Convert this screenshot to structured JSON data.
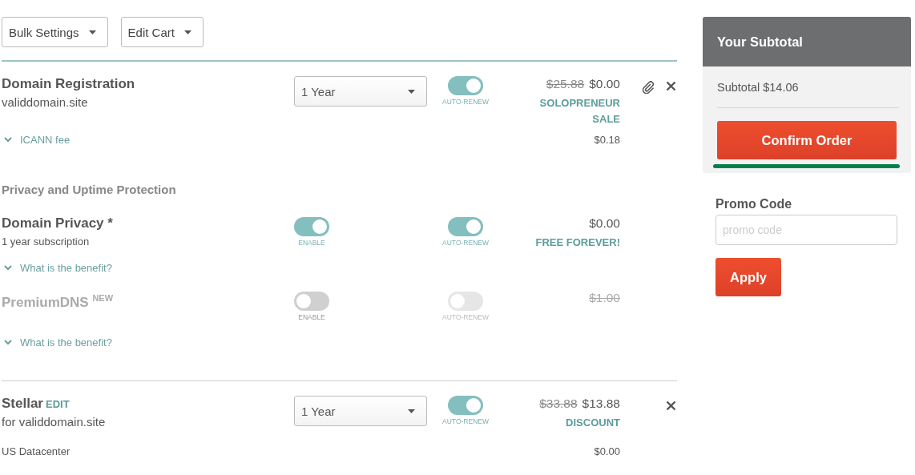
{
  "toolbar": [
    {
      "label": "Bulk Settings"
    },
    {
      "label": "Edit Cart"
    }
  ],
  "cart": {
    "items": [
      {
        "kind": "product",
        "title": "Domain Registration",
        "subtitle": "validdomain.site",
        "term": "1 Year",
        "auto_renew": {
          "label": "AUTO-RENEW",
          "on": true,
          "disabled": false
        },
        "old_price": "$25.88",
        "price": "$0.00",
        "promo": "SOLOPRENEUR SALE",
        "attachable": true,
        "removable": true,
        "detail": {
          "label": "ICANN fee",
          "expandable": true,
          "price": "$0.18"
        }
      },
      {
        "kind": "heading",
        "title": "Privacy and Uptime Protection"
      },
      {
        "kind": "addon",
        "title": "Domain Privacy *",
        "subtitle": "1 year subscription",
        "disabled": false,
        "enable": {
          "label": "ENABLE",
          "on": true
        },
        "auto_renew": {
          "label": "AUTO-RENEW",
          "on": true,
          "disabled": false
        },
        "price": "$0.00",
        "price_struck": false,
        "promo": "FREE FOREVER!",
        "detail": {
          "label": "What is the benefit?",
          "expandable": true
        }
      },
      {
        "kind": "addon",
        "title": "PremiumDNS $^{NEW}$",
        "disabled": true,
        "enable": {
          "label": "ENABLE",
          "on": false
        },
        "auto_renew": {
          "label": "AUTO-RENEW",
          "on": false,
          "disabled": true
        },
        "price": "$1.00",
        "price_struck": true,
        "detail": {
          "label": "What is the benefit?",
          "expandable": true
        }
      },
      {
        "kind": "divider"
      },
      {
        "kind": "product",
        "title": "Stellar",
        "title_link": "EDIT",
        "subtitle": "for validdomain.site",
        "term": "1 Year",
        "auto_renew": {
          "label": "AUTO-RENEW",
          "on": true,
          "disabled": false
        },
        "old_price": "$33.88",
        "price": "$13.88",
        "promo": "DISCOUNT",
        "attachable": false,
        "removable": true,
        "detail": {
          "label": "US Datacenter",
          "expandable": false,
          "price": "$0.00"
        }
      }
    ]
  },
  "summary": {
    "title": "Your Subtotal",
    "subtotal": "Subtotal $14.06",
    "confirm": "Confirm Order",
    "promo_label": "Promo Code",
    "promo_placeholder": "promo code",
    "apply": "Apply"
  }
}
